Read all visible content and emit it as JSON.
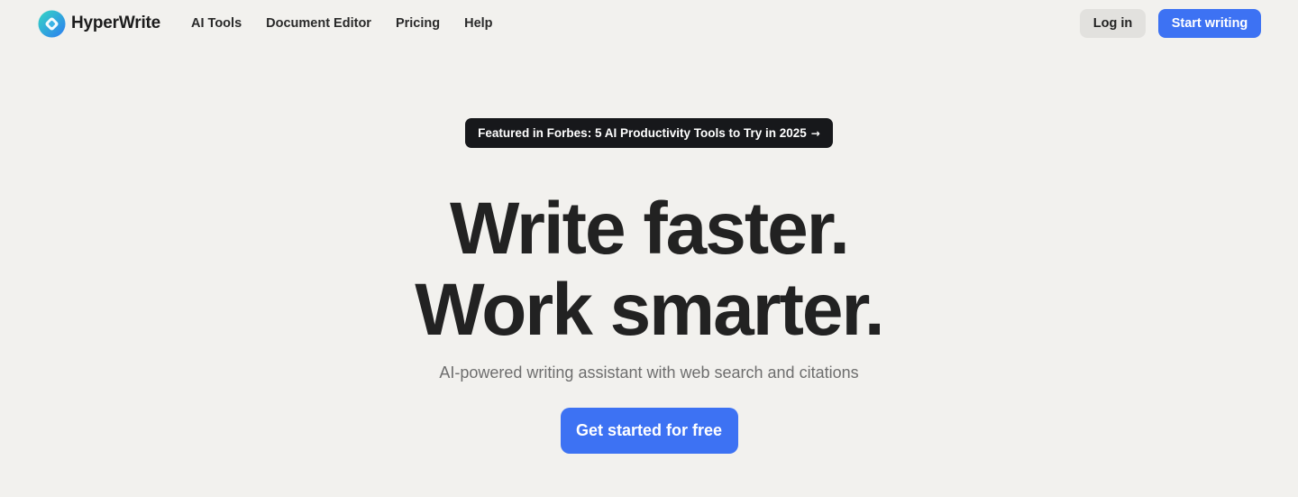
{
  "brand": {
    "name": "HyperWrite",
    "colors": {
      "accent": "#3d72f3",
      "logo_gradient_start": "#2fd1c6",
      "logo_gradient_end": "#2e7ff0",
      "badge_bg": "#17181b",
      "page_bg": "#f2f1ee"
    }
  },
  "nav": {
    "items": [
      {
        "label": "AI Tools"
      },
      {
        "label": "Document Editor"
      },
      {
        "label": "Pricing"
      },
      {
        "label": "Help"
      }
    ]
  },
  "header": {
    "login_label": "Log in",
    "start_label": "Start writing"
  },
  "hero": {
    "badge_text": "Featured in Forbes: 5 AI Productivity Tools to Try in 2025",
    "badge_icon": "arrow-right-icon",
    "badge_arrow": "→",
    "headline_line1": "Write faster.",
    "headline_line2": "Work smarter.",
    "subheadline": "AI-powered writing assistant with web search and citations",
    "cta_label": "Get started for free"
  }
}
